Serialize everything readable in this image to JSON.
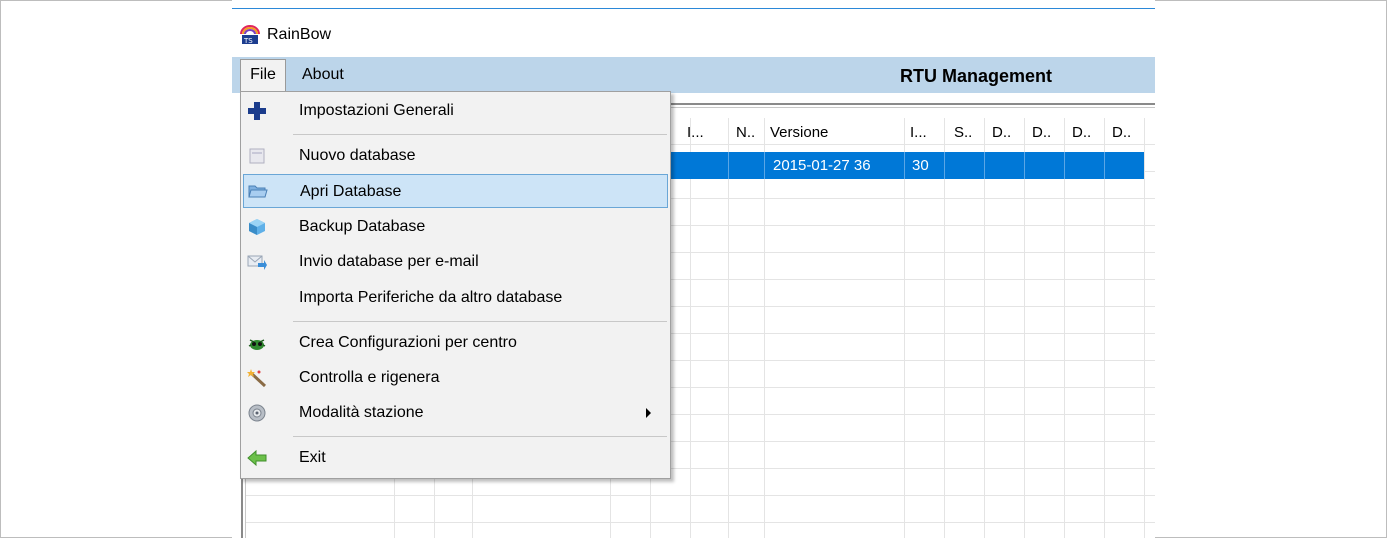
{
  "app": {
    "title": "RainBow"
  },
  "menubar": {
    "file": "File",
    "about": "About",
    "section_title": "RTU Management"
  },
  "grid": {
    "columns": [
      "I...",
      "N..",
      "Versione",
      "I...",
      "S..",
      "D..",
      "D..",
      "D..",
      "D.."
    ],
    "selected_row": {
      "versione": "2015-01-27 36",
      "value": "30"
    }
  },
  "file_menu": {
    "items": [
      {
        "label": "Impostazioni Generali",
        "icon": "plus-icon"
      },
      {
        "label": "Nuovo database",
        "icon": "new-database-icon"
      },
      {
        "label": "Apri Database",
        "icon": "folder-open-icon"
      },
      {
        "label": "Backup Database",
        "icon": "cube-backup-icon"
      },
      {
        "label": "Invio database per e-mail",
        "icon": "email-send-icon"
      },
      {
        "label": "Importa Periferiche da altro database",
        "icon": ""
      },
      {
        "label": "Crea Configurazioni per centro",
        "icon": "bug-config-icon"
      },
      {
        "label": "Controlla e rigenera",
        "icon": "magic-wand-icon"
      },
      {
        "label": "Modalità stazione",
        "icon": "gear-station-icon"
      },
      {
        "label": "Exit",
        "icon": "arrow-left-icon"
      }
    ],
    "highlighted": "Apri Database"
  },
  "colors": {
    "menubar": "#bcd5ea",
    "selection": "#0078d7",
    "menu_highlight": "#cde4f7"
  }
}
